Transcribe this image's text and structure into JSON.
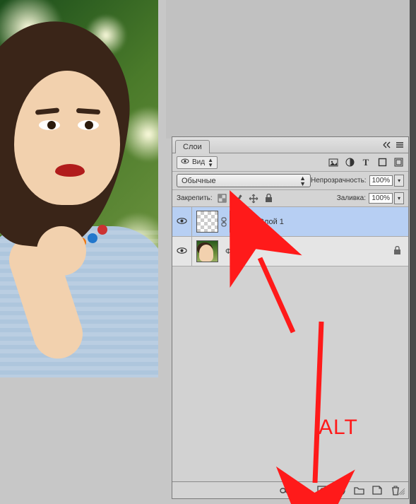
{
  "panel": {
    "tab_label": "Слои",
    "filter": {
      "kind_label": "Вид"
    },
    "blend": {
      "mode": "Обычные",
      "opacity_label": "Непрозрачность:",
      "opacity": "100%"
    },
    "lock": {
      "label": "Закрепить:",
      "fill_label": "Заливка:",
      "fill": "100%"
    },
    "layers": [
      {
        "name": "Слой 1",
        "has_mask": true,
        "locked": false,
        "selected": true
      },
      {
        "name": "Фон",
        "has_mask": false,
        "locked": true,
        "selected": false
      }
    ]
  },
  "annotation": {
    "text": "ALT"
  }
}
